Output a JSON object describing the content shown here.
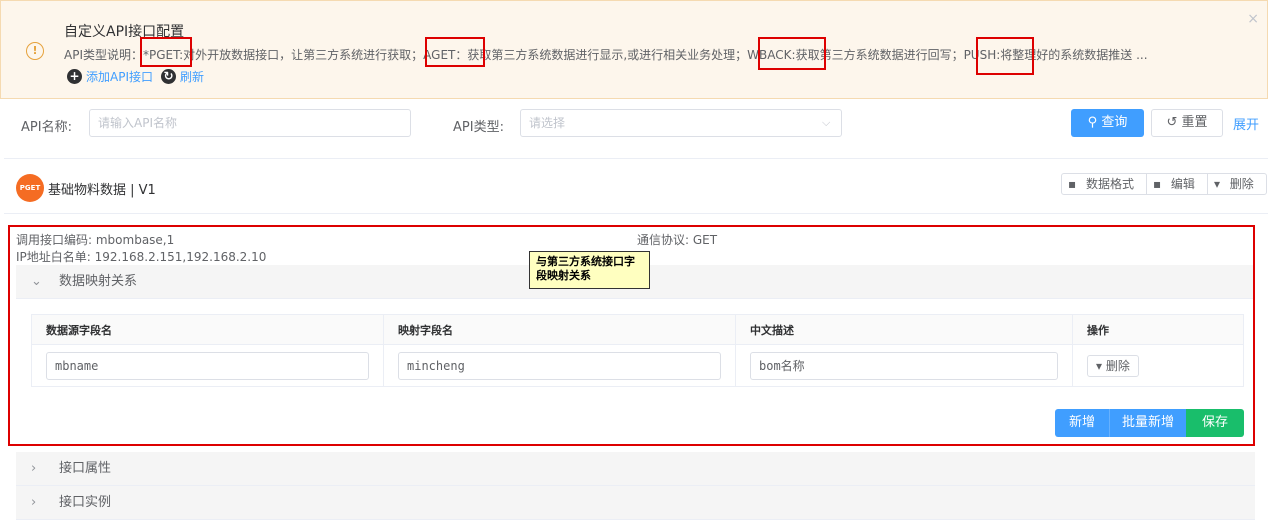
{
  "alert": {
    "icon": "!",
    "title": "自定义API接口配置",
    "description": "API类型说明：*PGET:对外开放数据接口，让第三方系统进行获取；AGET：获取第三方系统数据进行显示,或进行相关业务处理；WBACK:获取第三方系统数据进行回写；PUSH:将整理好的系统数据推送 ...",
    "close": "×",
    "add_label": "添加API接口",
    "refresh_label": "刷新"
  },
  "search": {
    "name_label": "API名称:",
    "name_placeholder": "请输入API名称",
    "type_label": "API类型:",
    "type_placeholder": "请选择",
    "query_button": "查询",
    "reset_button": "重置",
    "expand_label": "展开"
  },
  "card": {
    "badge": "PGET",
    "title": "基础物料数据 | V1",
    "buttons": {
      "format": "数据格式",
      "edit": "编辑",
      "delete": "删除"
    },
    "code_label": "调用接口编码: mbombase,1",
    "protocol_label": "通信协议: GET",
    "ip_label": "IP地址白名单:  192.168.2.151,192.168.2.10",
    "note": "与第三方系统接口字段映射关系"
  },
  "sections": {
    "mapping": "数据映射关系",
    "properties": "接口属性",
    "example": "接口实例"
  },
  "table": {
    "headers": [
      "数据源字段名",
      "映射字段名",
      "中文描述",
      "操作"
    ],
    "rows": [
      {
        "source": "mbname",
        "mapped": "mincheng",
        "desc": "bom名称",
        "delete": "删除"
      }
    ]
  },
  "actions": {
    "add": "新增",
    "batch_add": "批量新增",
    "save": "保存"
  },
  "colors": {
    "primary": "#409eff",
    "success": "#19be6b",
    "warning": "#e6a23c",
    "badge": "#f56c23",
    "highlight": "#dd0000"
  }
}
